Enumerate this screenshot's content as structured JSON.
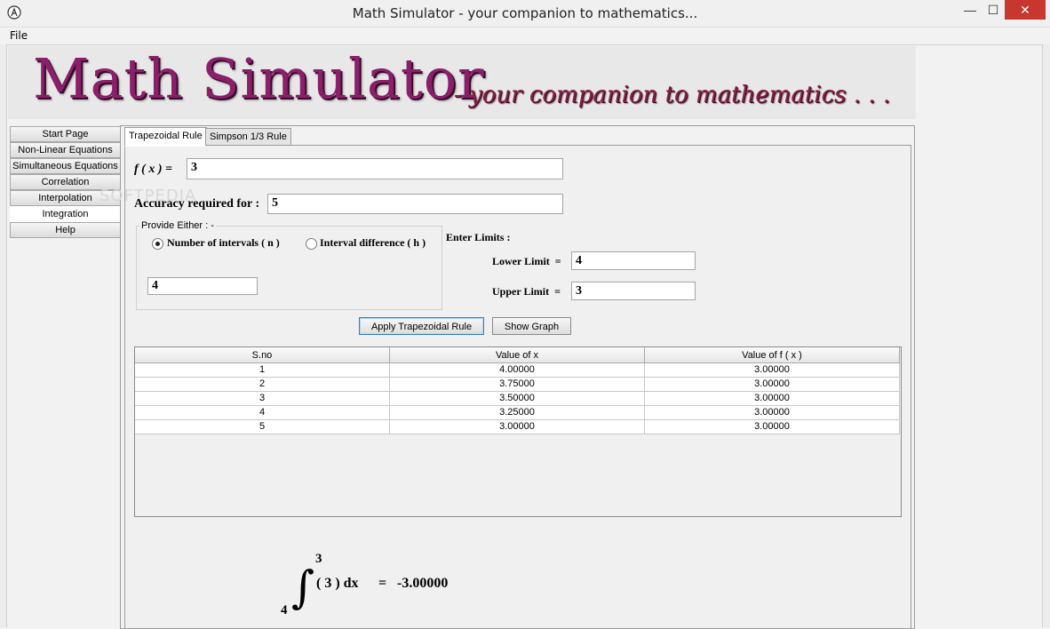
{
  "window": {
    "title": "Math Simulator - your companion to mathematics...",
    "minimize": "—",
    "maximize": "☐",
    "close": "✕"
  },
  "menu": {
    "file": "File"
  },
  "banner": {
    "title": "Math Simulator",
    "subtitle": "- your companion to mathematics . . ."
  },
  "sidebar": {
    "items": [
      {
        "label": "Start Page"
      },
      {
        "label": "Non-Linear Equations"
      },
      {
        "label": "Simultaneous Equations"
      },
      {
        "label": "Correlation"
      },
      {
        "label": "Interpolation"
      },
      {
        "label": "Integration"
      },
      {
        "label": "Help"
      }
    ],
    "active": "Integration"
  },
  "tabs": [
    {
      "label": "Trapezoidal Rule"
    },
    {
      "label": "Simpson 1/3 Rule"
    }
  ],
  "form": {
    "fx_label": "f ( x ) =",
    "fx_value": "3",
    "accuracy_label": "Accuracy required for :",
    "accuracy_value": "5",
    "provide_either": "Provide Either : -",
    "radio_intervals": "Number of intervals ( n )",
    "radio_difference": "Interval difference ( h )",
    "intervals_value": "4",
    "enter_limits": "Enter Limits :",
    "lower_label": "Lower Limit  =",
    "lower_value": "4",
    "upper_label": "Upper Limit  =",
    "upper_value": "3"
  },
  "buttons": {
    "apply": "Apply Trapezoidal Rule",
    "graph": "Show Graph"
  },
  "table": {
    "headers": [
      "S.no",
      "Value of x",
      "Value of f ( x )"
    ],
    "rows": [
      [
        "1",
        "4.00000",
        "3.00000"
      ],
      [
        "2",
        "3.75000",
        "3.00000"
      ],
      [
        "3",
        "3.50000",
        "3.00000"
      ],
      [
        "4",
        "3.25000",
        "3.00000"
      ],
      [
        "5",
        "3.00000",
        "3.00000"
      ]
    ]
  },
  "result": {
    "upper": "3",
    "lower": "4",
    "integral_sign": "∫",
    "integrand": "( 3 ) dx",
    "equals": "=",
    "value": "-3.00000"
  },
  "watermark": "SOFTPEDIA"
}
